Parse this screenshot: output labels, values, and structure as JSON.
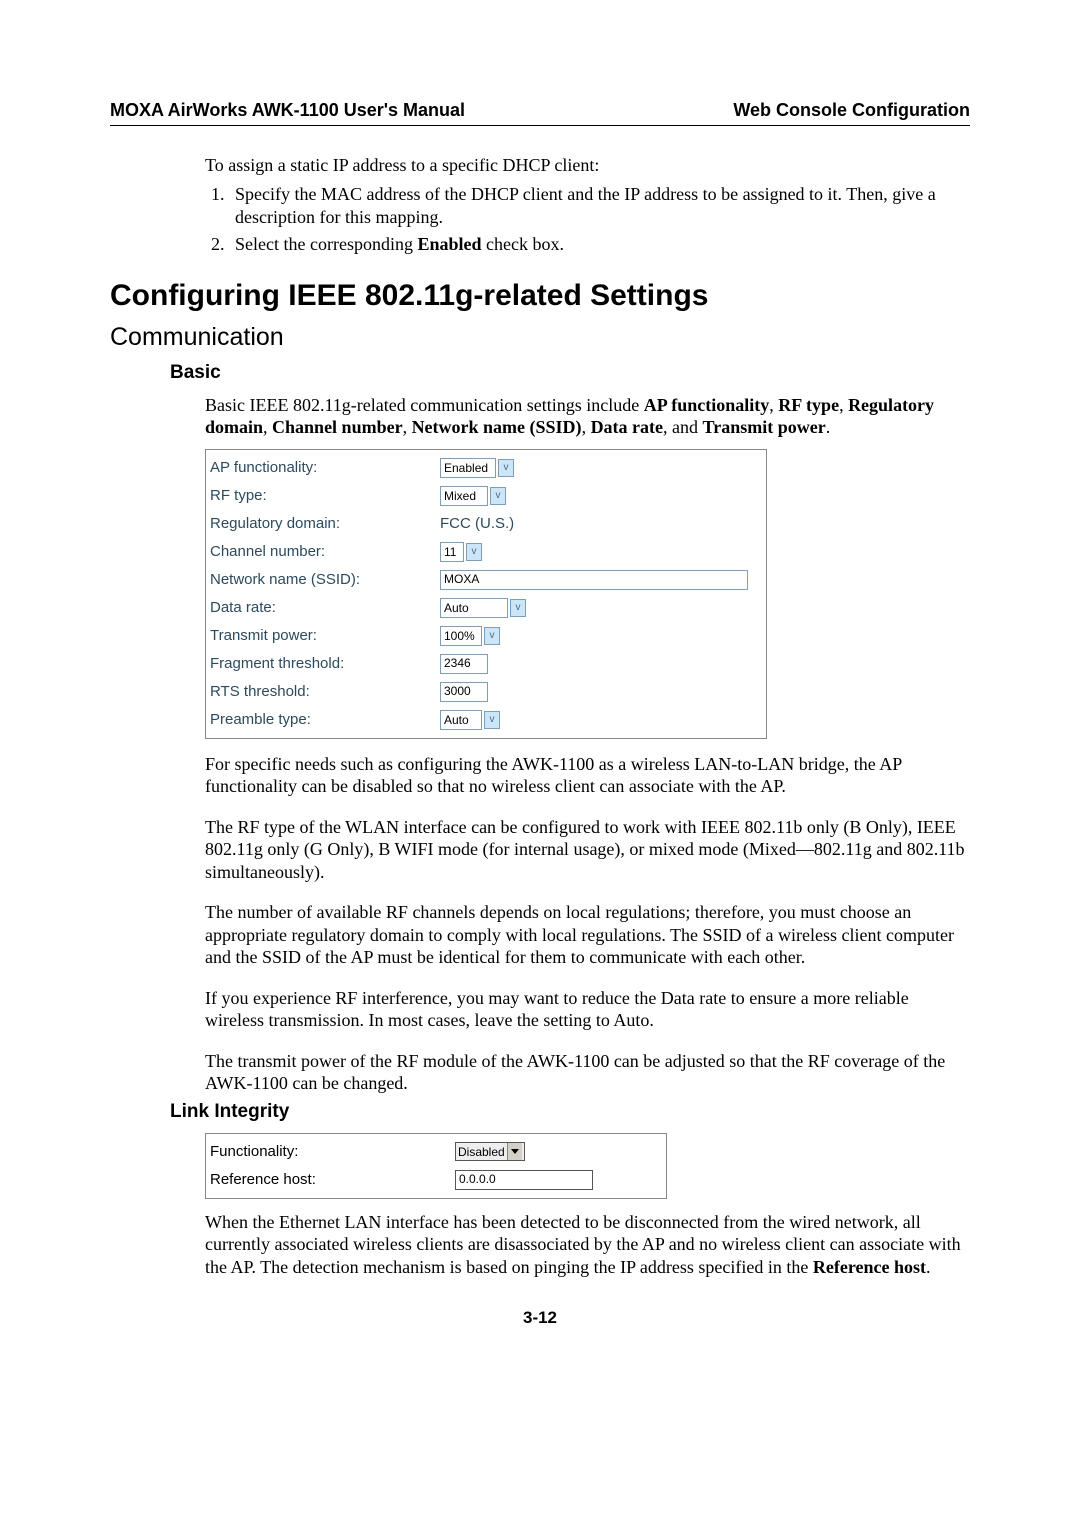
{
  "header": {
    "left": "MOXA AirWorks AWK-1100 User's Manual",
    "right": "Web Console Configuration"
  },
  "intro": {
    "lead": "To assign a static IP address to a specific DHCP client:",
    "step1": "Specify the MAC address of the DHCP client and the IP address to be assigned to it. Then, give a description for this mapping.",
    "step2_a": "Select the corresponding ",
    "step2_b": "Enabled",
    "step2_c": " check box."
  },
  "h1": "Configuring IEEE 802.11g-related Settings",
  "h2": "Communication",
  "h3a": "Basic",
  "basic_intro_a": "Basic IEEE 802.11g-related communication settings include ",
  "basic_intro_b": "AP functionality",
  "basic_intro_c": ", ",
  "basic_intro_d": "RF type",
  "basic_intro_e": ", ",
  "basic_intro_f": "Regulatory domain",
  "basic_intro_g": ", ",
  "basic_intro_h": "Channel number",
  "basic_intro_i": ", ",
  "basic_intro_j": "Network name (SSID)",
  "basic_intro_k": ", ",
  "basic_intro_l": "Data rate",
  "basic_intro_m": ", and ",
  "basic_intro_n": "Transmit power",
  "basic_intro_o": ".",
  "form1": {
    "ap_func": {
      "label": "AP functionality:",
      "value": "Enabled"
    },
    "rf_type": {
      "label": "RF type:",
      "value": "Mixed"
    },
    "reg_domain": {
      "label": "Regulatory domain:",
      "value": "FCC (U.S.)"
    },
    "channel": {
      "label": "Channel number:",
      "value": "11"
    },
    "ssid": {
      "label": "Network name (SSID):",
      "value": "MOXA"
    },
    "data_rate": {
      "label": "Data rate:",
      "value": "Auto"
    },
    "tx_power": {
      "label": "Transmit power:",
      "value": "100%"
    },
    "frag": {
      "label": "Fragment threshold:",
      "value": "2346"
    },
    "rts": {
      "label": "RTS threshold:",
      "value": "3000"
    },
    "preamble": {
      "label": "Preamble type:",
      "value": "Auto"
    }
  },
  "para1": "For specific needs such as configuring the AWK-1100 as a wireless LAN-to-LAN bridge, the AP functionality can be disabled so that no wireless client can associate with the AP.",
  "para2": "The RF type of the WLAN interface can be configured to work with IEEE 802.11b only (B Only), IEEE 802.11g only (G Only), B WIFI mode (for internal usage), or mixed mode (Mixed—802.11g and 802.11b simultaneously).",
  "para3": "The number of available RF channels depends on local regulations; therefore, you must choose an appropriate regulatory domain to comply with local regulations. The SSID of a wireless client computer and the SSID of the AP must be identical for them to communicate with each other.",
  "para4": "If you experience RF interference, you may want to reduce the Data rate to ensure a more reliable wireless transmission. In most cases, leave the setting to Auto.",
  "para5": "The transmit power of the RF module of the AWK-1100 can be adjusted so that the RF coverage of the AWK-1100 can be changed.",
  "h3b": "Link Integrity",
  "form2": {
    "func": {
      "label": "Functionality:",
      "value": "Disabled"
    },
    "refhost": {
      "label": "Reference host:",
      "value": "0.0.0.0"
    }
  },
  "para6_a": "When the Ethernet LAN interface has been detected to be disconnected from the wired network, all currently associated wireless clients are disassociated by the AP and no wireless client can associate with the AP. The detection mechanism is based on pinging the IP address specified in the ",
  "para6_b": "Reference host",
  "para6_c": ".",
  "pagenum": "3-12"
}
